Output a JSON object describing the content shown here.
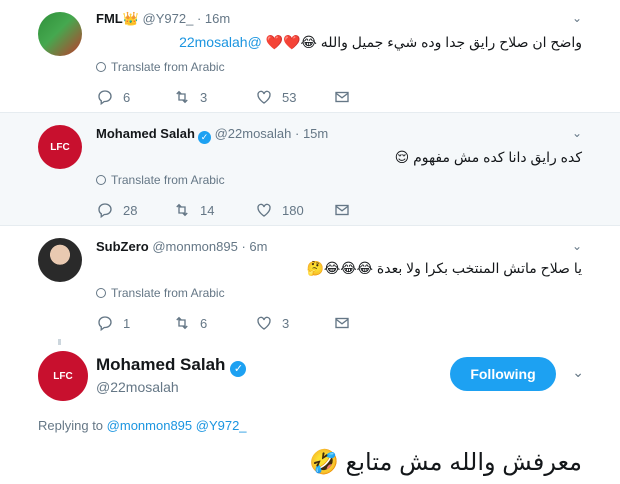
{
  "tweets": [
    {
      "name": "FML",
      "name_suffix": "👑",
      "handle": "@Y972_",
      "time": "· 16m",
      "text": "واضح ان صلاح رايق جدا وده شيء جميل والله",
      "text_emoji": "😂❤️❤️",
      "mention": "@22mosalah",
      "translate": "Translate from Arabic",
      "replies": "6",
      "retweets": "3",
      "likes": "53",
      "verified": false
    },
    {
      "name": "Mohamed Salah",
      "handle": "@22mosalah",
      "time": "· 15m",
      "text": "كده رايق دانا كده مش مفهوم",
      "text_emoji": "😌",
      "translate": "Translate from Arabic",
      "replies": "28",
      "retweets": "14",
      "likes": "180",
      "verified": true
    },
    {
      "name": "SubZero",
      "handle": "@monmon895",
      "time": "· 6m",
      "text": "يا صلاح ماتش المنتخب بكرا ولا بعدة",
      "text_emoji": "😂😂😂🤔",
      "translate": "Translate from Arabic",
      "replies": "1",
      "retweets": "6",
      "likes": "3",
      "verified": false
    }
  ],
  "focus": {
    "name": "Mohamed Salah",
    "handle": "@22mosalah",
    "follow_label": "Following",
    "replying_prefix": "Replying to",
    "replying_to": "@monmon895 @Y972_",
    "text": "معرفش والله مش متابع",
    "text_emoji": "🤣"
  },
  "icons": [
    "reply-icon",
    "retweet-icon",
    "like-icon",
    "dm-icon",
    "globe-icon",
    "verified-icon",
    "chevron-down-icon"
  ],
  "colors": {
    "accent": "#1da1f2",
    "link": "#1b95e0",
    "muted": "#657786",
    "hover_bg": "#f5f8fa"
  }
}
